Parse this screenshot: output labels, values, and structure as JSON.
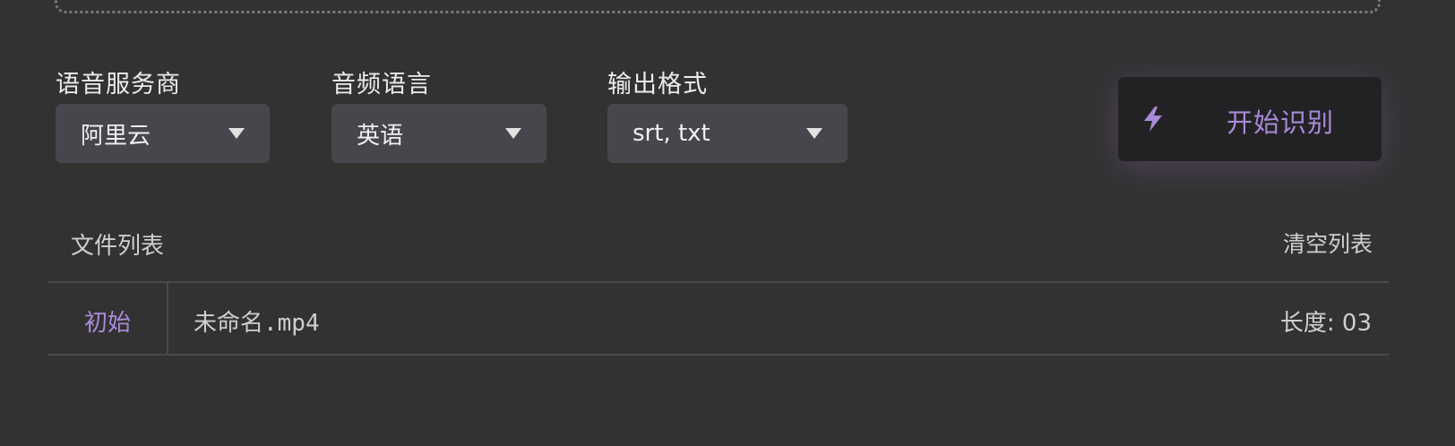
{
  "fields": {
    "provider": {
      "label": "语音服务商",
      "value": "阿里云"
    },
    "language": {
      "label": "音频语言",
      "value": "英语"
    },
    "format": {
      "label": "输出格式",
      "value": "srt, txt"
    }
  },
  "start_button": {
    "label": "开始识别",
    "icon": "lightning-icon"
  },
  "file_list": {
    "title": "文件列表",
    "clear_label": "清空列表",
    "rows": [
      {
        "status": "初始",
        "name": "未命名.mp4",
        "length": "长度: 03"
      }
    ]
  },
  "colors": {
    "background": "#323232",
    "select_bg": "#46474c",
    "button_bg": "#222224",
    "accent": "#a98ad8"
  }
}
